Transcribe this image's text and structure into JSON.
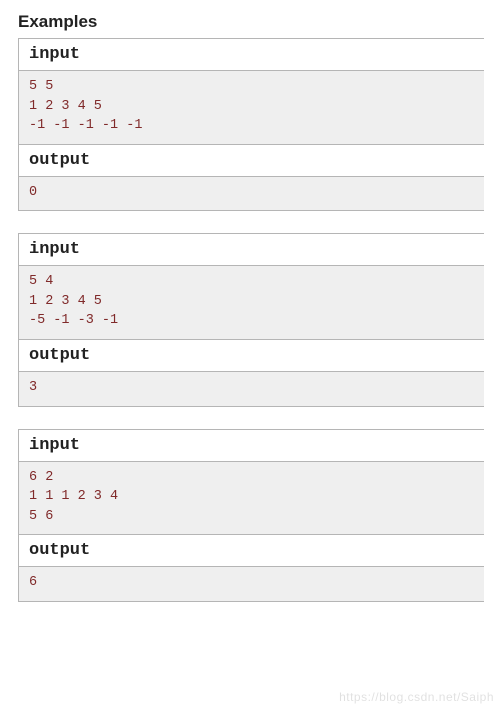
{
  "title": "Examples",
  "labels": {
    "input": "input",
    "output": "output"
  },
  "examples": [
    {
      "input": "5 5\n1 2 3 4 5\n-1 -1 -1 -1 -1",
      "output": "0"
    },
    {
      "input": "5 4\n1 2 3 4 5\n-5 -1 -3 -1",
      "output": "3"
    },
    {
      "input": "6 2\n1 1 1 2 3 4\n5 6",
      "output": "6"
    }
  ],
  "watermark": "https://blog.csdn.net/Saiph"
}
